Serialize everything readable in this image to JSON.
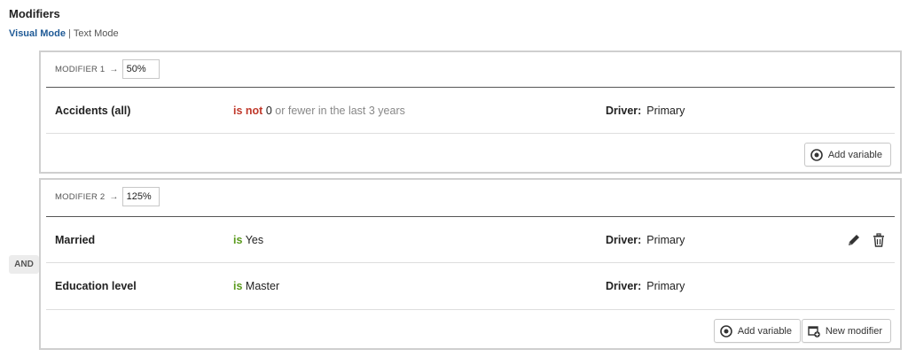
{
  "header": {
    "title": "Modifiers"
  },
  "modes": {
    "visual": "Visual Mode",
    "separator": "|",
    "text": "Text Mode"
  },
  "and_badge": "AND",
  "modifiers": [
    {
      "label": "MODIFIER 1",
      "arrow": "→",
      "value": "50%",
      "rows": [
        {
          "name": "Accidents (all)",
          "operator": "is not",
          "value": "0",
          "suffix": "or fewer in the last 3 years",
          "driver_label": "Driver:",
          "driver_value": "Primary"
        }
      ],
      "buttons": {
        "add_variable": "Add variable"
      }
    },
    {
      "label": "MODIFIER 2",
      "arrow": "→",
      "value": "125%",
      "rows": [
        {
          "name": "Married",
          "operator": "is",
          "value": "Yes",
          "driver_label": "Driver:",
          "driver_value": "Primary"
        },
        {
          "name": "Education level",
          "operator": "is",
          "value": "Master",
          "driver_label": "Driver:",
          "driver_value": "Primary"
        }
      ],
      "buttons": {
        "add_variable": "Add variable",
        "new_modifier": "New modifier"
      }
    }
  ],
  "icons": {
    "add_variable": "target-icon",
    "new_modifier": "new-window-icon",
    "edit": "pencil-icon",
    "delete": "trash-icon"
  },
  "colors": {
    "link": "#1f5a96",
    "negative": "#c0392b",
    "positive": "#5a9a1d"
  }
}
